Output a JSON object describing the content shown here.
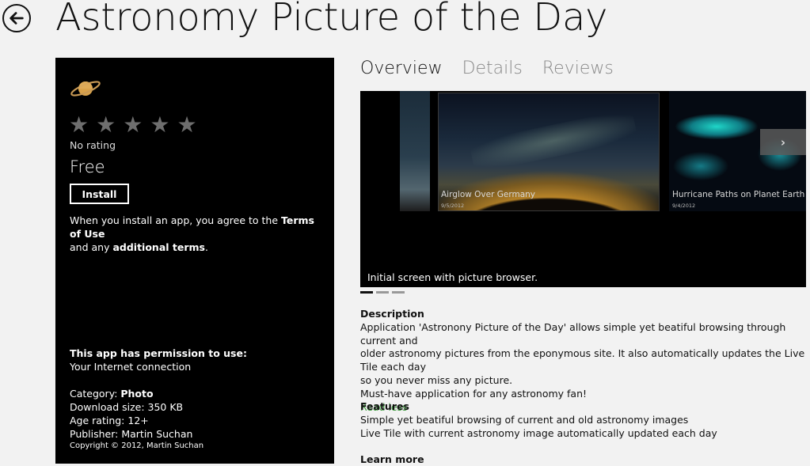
{
  "header": {
    "title": "Astronomy Picture of the Day"
  },
  "sidebar": {
    "no_rating": "No rating",
    "price": "Free",
    "install_label": "Install",
    "terms_part1": "When you install an app, you agree to the ",
    "terms_link": "Terms of Use",
    "terms_part2": "and any ",
    "additional_link": "additional terms",
    "terms_end": ".",
    "permission_title": "This app has permission to use:",
    "permission_item": "Your Internet connection",
    "category_label": "Category: ",
    "category_value": "Photo",
    "download_size": "Download size: 350 KB",
    "age_rating": "Age rating: 12+",
    "publisher": "Publisher: Martin Suchan",
    "copyright": "Copyright © 2012, Martin Suchan"
  },
  "tabs": [
    {
      "label": "Overview",
      "active": true
    },
    {
      "label": "Details",
      "active": false
    },
    {
      "label": "Reviews",
      "active": false
    }
  ],
  "screenshot": {
    "thumb_main_title": "Airglow Over Germany",
    "thumb_main_date": "9/5/2012",
    "thumb_right_title": "Hurricane Paths on Planet Earth",
    "thumb_right_date": "9/4/2012",
    "next_glyph": "›",
    "caption": "Initial screen with picture browser."
  },
  "description": {
    "title": "Description",
    "line1": "Application 'Astronony Picture of the Day' allows simple yet beatiful browsing through current and",
    "line2": "older astronomy pictures from the eponymous site. It also automatically updates the Live Tile each day",
    "line3": "so you never miss any picture.",
    "line4": "Must-have application for any astronomy fan!",
    "read_less": "Read less"
  },
  "features": {
    "title": "Features",
    "items": [
      "Simple yet beatiful browsing of current and old astronomy images",
      "Live Tile with current astronomy image automatically updated each day"
    ]
  },
  "learn_more": {
    "title": "Learn more"
  },
  "colors": {
    "accent_link": "#3a9a3a",
    "panel_bg": "#000000",
    "page_bg": "#f2f2f2"
  }
}
